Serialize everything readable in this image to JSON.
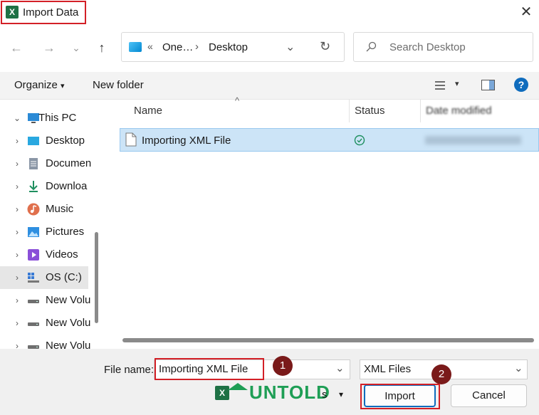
{
  "window": {
    "title": "Import Data",
    "app_icon_letter": "X",
    "close_glyph": "✕"
  },
  "nav": {
    "back_glyph": "←",
    "forward_glyph": "→",
    "recent_glyph": "⌄",
    "up_glyph": "↑",
    "address": {
      "overflow": "«",
      "segments": [
        "One…",
        "Desktop"
      ],
      "separator": "›",
      "dropdown_glyph": "⌄",
      "refresh_glyph": "↻"
    },
    "search": {
      "placeholder": "Search Desktop"
    }
  },
  "commandbar": {
    "organize": "Organize",
    "organize_caret": "▾",
    "new_folder": "New folder",
    "view_caret": "▾",
    "help_glyph": "?"
  },
  "sidebar": {
    "items": [
      {
        "label": "This PC",
        "chevron": "⌄",
        "icon": "monitor-icon"
      },
      {
        "label": "Desktop",
        "chevron": "›",
        "icon": "desktop-icon"
      },
      {
        "label": "Documen",
        "chevron": "›",
        "icon": "documents-icon"
      },
      {
        "label": "Downloa",
        "chevron": "›",
        "icon": "download-icon"
      },
      {
        "label": "Music",
        "chevron": "›",
        "icon": "music-icon"
      },
      {
        "label": "Pictures",
        "chevron": "›",
        "icon": "pictures-icon"
      },
      {
        "label": "Videos",
        "chevron": "›",
        "icon": "videos-icon"
      },
      {
        "label": "OS (C:)",
        "chevron": "›",
        "icon": "os-drive-icon"
      },
      {
        "label": "New Volu",
        "chevron": "›",
        "icon": "drive-icon"
      },
      {
        "label": "New Volu",
        "chevron": "›",
        "icon": "drive-icon"
      },
      {
        "label": "New Volu",
        "chevron": "›",
        "icon": "drive-icon"
      }
    ]
  },
  "filelist": {
    "sort_glyph": "^",
    "columns": {
      "name": "Name",
      "status": "Status",
      "date": "Date modified"
    },
    "rows": [
      {
        "name": "Importing XML File",
        "status": "synced-check-icon"
      }
    ]
  },
  "footer": {
    "file_name_label": "File name:",
    "file_name_value": "Importing XML File",
    "combo_glyph": "⌄",
    "file_type": "XML Files",
    "tools_suffix": "s",
    "tools_caret": "▾",
    "import_label": "Import",
    "cancel_label": "Cancel",
    "badges": [
      "1",
      "2"
    ]
  },
  "watermark": {
    "text": "UNTOLD"
  },
  "colors": {
    "highlight": "#d32027",
    "selection": "#cce4f7",
    "excel_green": "#1e7145",
    "help_blue": "#0f6cbd",
    "badge": "#7a1a1a"
  }
}
